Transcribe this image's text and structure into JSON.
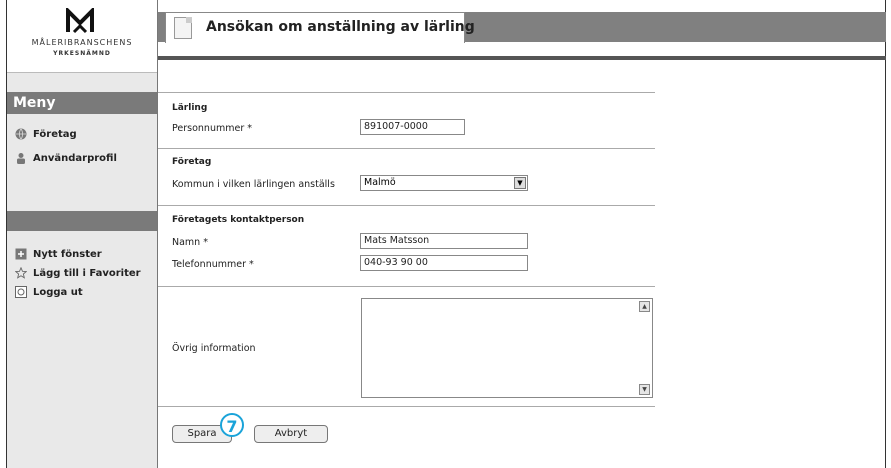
{
  "sidebar": {
    "logo_line1": "MÅLERIBRANSCHENS",
    "logo_line2": "YRKESNÄMND",
    "menu_title": "Meny",
    "items": [
      {
        "label": "Företag",
        "icon": "globe-icon"
      },
      {
        "label": "Användarprofil",
        "icon": "user-icon"
      }
    ],
    "tools": [
      {
        "label": "Nytt fönster",
        "icon": "new-window-icon"
      },
      {
        "label": "Lägg till i Favoriter",
        "icon": "star-icon"
      },
      {
        "label": "Logga ut",
        "icon": "logout-icon"
      }
    ]
  },
  "header": {
    "title": "Ansökan om anställning av lärling"
  },
  "form": {
    "section_larling": "Lärling",
    "personnummer_label": "Personnummer *",
    "personnummer_value": "891007-0000",
    "section_foretag": "Företag",
    "kommun_label": "Kommun i vilken lärlingen anställs",
    "kommun_value": "Malmö",
    "section_kontakt": "Företagets kontaktperson",
    "namn_label": "Namn *",
    "namn_value": "Mats Matsson",
    "telefon_label": "Telefonnummer *",
    "telefon_value": "040-93 90 00",
    "ovrig_label": "Övrig information",
    "ovrig_value": ""
  },
  "buttons": {
    "save": "Spara",
    "cancel": "Avbryt"
  },
  "callout": "7",
  "colors": {
    "accent": "#1aa3d9",
    "header_gray": "#808080"
  }
}
